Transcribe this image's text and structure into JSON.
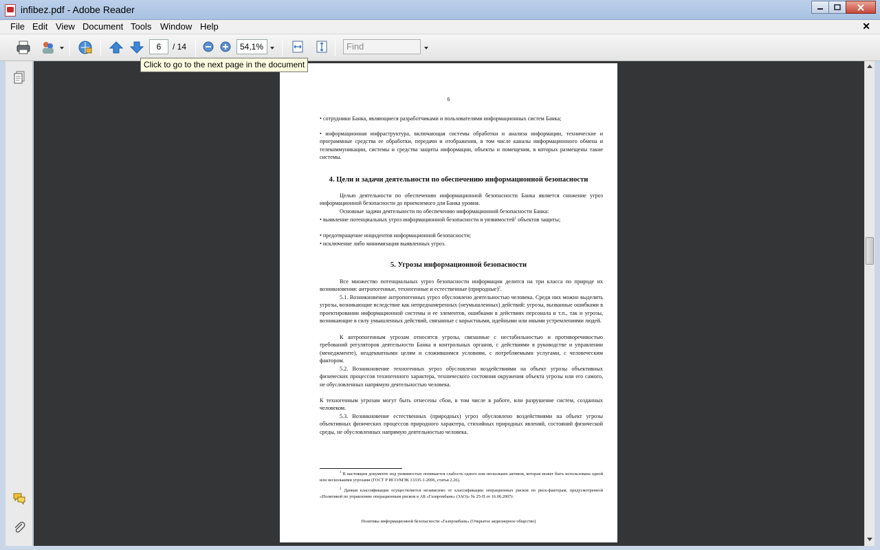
{
  "window": {
    "title": "infibez.pdf - Adobe Reader"
  },
  "menu": [
    "File",
    "Edit",
    "View",
    "Document",
    "Tools",
    "Window",
    "Help"
  ],
  "toolbar": {
    "page_current": "6",
    "page_total": "/ 14",
    "zoom": "54,1%",
    "find_placeholder": "Find",
    "tooltip": "Click to go to the next page in the document"
  },
  "document": {
    "page_number": "6",
    "bullets_top": [
      "•         сотрудники Банка, являющиеся разработчиками и пользователями информационных систем Банка;",
      "•         информационная инфраструктура, включающая системы обработки и анализа информации, технические и программные средства ее обработки, передачи и отображения, в том числе каналы информационного обмена и телекоммуникации, системы и средства защиты информации, объекты и помещения, в которых размещены такие системы."
    ],
    "section4_title": "4. Цели и задачи деятельности по обеспечению информационной безопасности",
    "section4_p1": "Целью деятельности по обеспечению информационной безопасности Банка является снижение угроз информационной безопасности до приемлемого для Банка уровня.",
    "section4_p2": "Основные задачи деятельности по обеспечению информационной безопасности Банка:",
    "section4_b1": "•         выявление потенциальных угроз информационной безопасности и уязвимостей",
    "section4_b1_sup": "1",
    "section4_b1_cont": " объектов защиты;",
    "section4_b2": "•         предотвращение инцидентов информационной безопасности;",
    "section4_b3": "•         исключение либо минимизация выявленных угроз.",
    "section5_title": "5. Угрозы информационной безопасности",
    "section5_p1": "Все множество потенциальных угроз безопасности информации делится на три класса по природе их возникновения: антропогенные, техногенные и естественные (природные)",
    "section5_p1_sup": "2",
    "section5_p2": "5.1.      Возникновение антропогенных угроз обусловлено деятельностью человека. Среди них можно выделить угрозы, возникающие вследствие как непреднамеренных (неумышленных) действий: угрозы, вызванные ошибками в проектировании информационной системы и ее элементов, ошибками в действиях персонала и т.п., так и угрозы, возникающие в силу умышленных действий, связанные с корыстными, идейными или иными устремлениями людей.",
    "section5_p3": "К антропогенным угрозам относятся угрозы, связанные с нестабильностью и противоречивостью требований регуляторов деятельности Банка и контрольных органов, с действиями в руководстве и управлении (менеджменте), неадекватными целям и сложившимся условиям, с потребляемыми услугами, с человеческим фактором.",
    "section5_p4": "5.2.      Возникновение техногенных угроз обусловлено воздействиями на объект угрозы объективных физических процессов техногенного характера, технического состояния окружения объекта угрозы или его самого, не обусловленных напрямую деятельностью человека.",
    "section5_p5": "К техногенным угрозам могут быть отнесены сбои, в том числе в работе, или разрушение систем, созданных человеком.",
    "section5_p6": "5.3.      Возникновение естественных (природных) угроз обусловлено воздействиями на объект угрозы объективных физических процессов природного характера, стихийных природных явлений, состояний физической среды, не обусловленных напрямую деятельностью человека.",
    "footnote1": "В настоящем документе под уязвимостью понимается слабость одного или нескольких активов, которая может быть использована одной или несколькими угрозами (ГОСТ Р ИСО/МЭК 13335-1-2006, статья 2.26).",
    "footnote1_mark": "1",
    "footnote2": "Данная классификация осуществляется независимо от классификации операционных рисков по риск-факторам, предусмотренной «Политикой по управлению операционным риском в АБ «Газпромбанк» (ЗАО)» № 25-П от 16.06.2007г.",
    "footnote2_mark": "2",
    "footer": "Политика информационной безопасности «Газпромбанк» (Открытое акционерное общество)"
  }
}
